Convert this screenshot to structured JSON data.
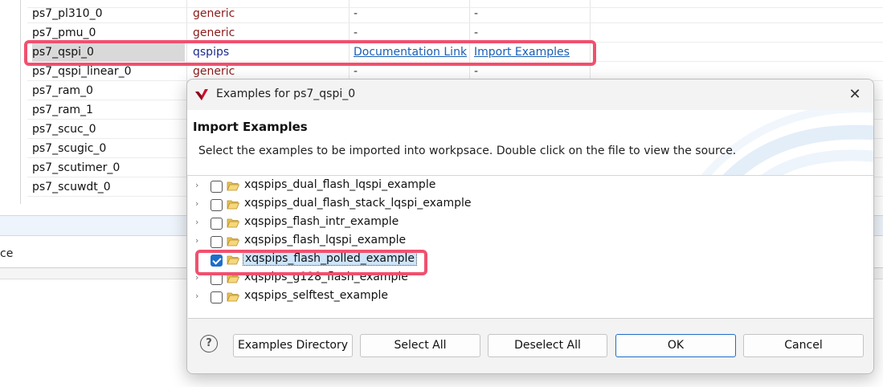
{
  "background_table": {
    "rows": [
      {
        "name": "ps7_pl310_0",
        "driver": "generic",
        "doc": "-",
        "import": "-"
      },
      {
        "name": "ps7_pmu_0",
        "driver": "generic",
        "doc": "-",
        "import": "-"
      },
      {
        "name": "ps7_qspi_0",
        "driver": "qspips",
        "doc": "Documentation Link",
        "import": "Import Examples"
      },
      {
        "name": "ps7_qspi_linear_0",
        "driver": "generic",
        "doc": "-",
        "import": "-"
      },
      {
        "name": "ps7_ram_0",
        "driver": "",
        "doc": "",
        "import": ""
      },
      {
        "name": "ps7_ram_1",
        "driver": "",
        "doc": "",
        "import": ""
      },
      {
        "name": "ps7_scuc_0",
        "driver": "",
        "doc": "",
        "import": ""
      },
      {
        "name": "ps7_scugic_0",
        "driver": "",
        "doc": "",
        "import": ""
      },
      {
        "name": "ps7_scutimer_0",
        "driver": "",
        "doc": "",
        "import": ""
      },
      {
        "name": "ps7_scuwdt_0",
        "driver": "",
        "doc": "",
        "import": ""
      }
    ],
    "selected_row": 2,
    "partial_label": "ce"
  },
  "dialog": {
    "title": "Examples for ps7_qspi_0",
    "heading": "Import Examples",
    "description": "Select the examples to be imported into workpsace. Double click on the file to view the source.",
    "examples": [
      {
        "label": "xqspips_dual_flash_lqspi_example",
        "checked": false
      },
      {
        "label": "xqspips_dual_flash_stack_lqspi_example",
        "checked": false
      },
      {
        "label": "xqspips_flash_intr_example",
        "checked": false
      },
      {
        "label": "xqspips_flash_lqspi_example",
        "checked": false
      },
      {
        "label": "xqspips_flash_polled_example",
        "checked": true
      },
      {
        "label": "xqspips_g128_flash_example",
        "checked": false
      },
      {
        "label": "xqspips_selftest_example",
        "checked": false
      }
    ],
    "buttons": {
      "help": "?",
      "examples_directory": "Examples Directory",
      "select_all": "Select All",
      "deselect_all": "Deselect All",
      "ok": "OK",
      "cancel": "Cancel"
    },
    "close_icon": "close-icon"
  },
  "colors": {
    "highlight": "#f0506e",
    "accent": "#1e6ec9",
    "link": "#1a5fb4"
  }
}
